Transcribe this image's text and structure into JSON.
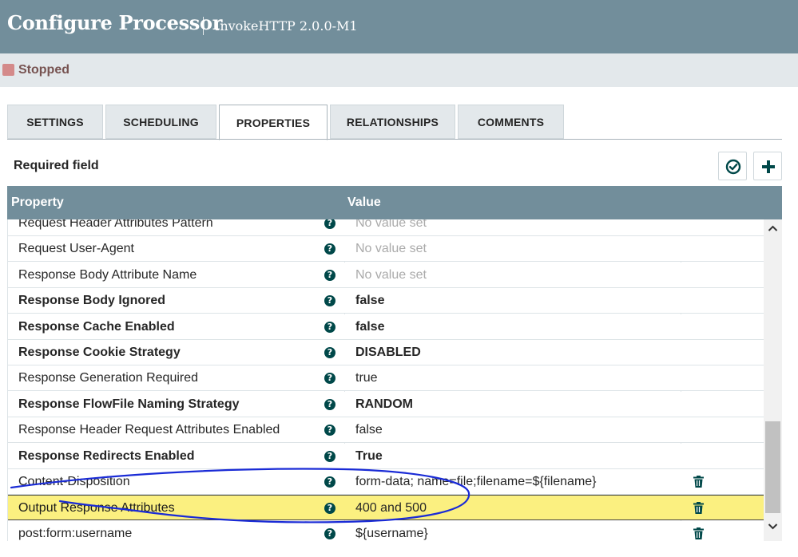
{
  "header": {
    "title": "Configure Processor",
    "subtitle": "InvokeHTTP 2.0.0-M1"
  },
  "status": {
    "label": "Stopped",
    "color": "#d48a8a"
  },
  "tabs": [
    {
      "label": "SETTINGS",
      "active": false
    },
    {
      "label": "SCHEDULING",
      "active": false
    },
    {
      "label": "PROPERTIES",
      "active": true
    },
    {
      "label": "RELATIONSHIPS",
      "active": false
    },
    {
      "label": "COMMENTS",
      "active": false
    }
  ],
  "toolbar": {
    "required_field_label": "Required field",
    "verify_icon": "check-circle-icon",
    "add_icon": "plus-icon"
  },
  "table": {
    "headers": {
      "property": "Property",
      "value": "Value"
    },
    "rows": [
      {
        "name": "Request Header Attributes Pattern",
        "value": "No value set",
        "required": false,
        "empty": true,
        "deletable": false,
        "selected": false
      },
      {
        "name": "Request User-Agent",
        "value": "No value set",
        "required": false,
        "empty": true,
        "deletable": false,
        "selected": false
      },
      {
        "name": "Response Body Attribute Name",
        "value": "No value set",
        "required": false,
        "empty": true,
        "deletable": false,
        "selected": false
      },
      {
        "name": "Response Body Ignored",
        "value": "false",
        "required": true,
        "empty": false,
        "deletable": false,
        "selected": false
      },
      {
        "name": "Response Cache Enabled",
        "value": "false",
        "required": true,
        "empty": false,
        "deletable": false,
        "selected": false
      },
      {
        "name": "Response Cookie Strategy",
        "value": "DISABLED",
        "required": true,
        "empty": false,
        "deletable": false,
        "selected": false
      },
      {
        "name": "Response Generation Required",
        "value": "true",
        "required": false,
        "empty": false,
        "deletable": false,
        "selected": false
      },
      {
        "name": "Response FlowFile Naming Strategy",
        "value": "RANDOM",
        "required": true,
        "empty": false,
        "deletable": false,
        "selected": false
      },
      {
        "name": "Response Header Request Attributes Enabled",
        "value": "false",
        "required": false,
        "empty": false,
        "deletable": false,
        "selected": false
      },
      {
        "name": "Response Redirects Enabled",
        "value": "True",
        "required": true,
        "empty": false,
        "deletable": false,
        "selected": false
      },
      {
        "name": "Content-Disposition",
        "value": "form-data; name=file;filename=${filename}",
        "required": false,
        "empty": false,
        "deletable": true,
        "selected": false
      },
      {
        "name": "Output Response Attributes",
        "value": "400 and 500",
        "required": false,
        "empty": false,
        "deletable": true,
        "selected": true
      },
      {
        "name": "post:form:username",
        "value": "${username}",
        "required": false,
        "empty": false,
        "deletable": true,
        "selected": false
      }
    ]
  },
  "colors": {
    "header_bg": "#728e9b",
    "selected_row": "#fbf080",
    "help_icon": "#004849",
    "annotation_ink": "#1a2bd6"
  }
}
